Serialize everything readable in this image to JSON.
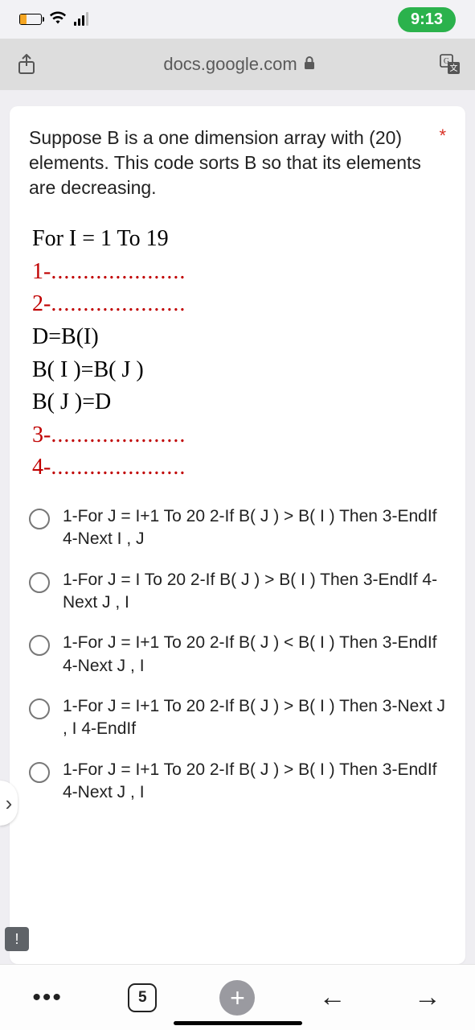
{
  "status": {
    "time": "9:13"
  },
  "browser": {
    "url": "docs.google.com"
  },
  "question": {
    "text": "Suppose B is a one dimension array with (20) elements. This code sorts B so that its elements are decreasing.",
    "required_marker": "*"
  },
  "code": {
    "line1": "For I = 1 To 19",
    "blank1_label": "1-",
    "blank2_label": "2-",
    "line_d": "D=B(I)",
    "line_bi": "B( I )=B( J )",
    "line_bj": "B( J )=D",
    "blank3_label": "3-",
    "blank4_label": "4-",
    "dots": "....................."
  },
  "options": [
    "1-For J = I+1 To 20 2-If B( J ) > B( I ) Then 3-EndIf 4-Next I , J",
    "1-For J = I To 20 2-If B( J ) > B( I ) Then 3-EndIf 4-Next J , I",
    "1-For J = I+1 To 20 2-If B( J ) < B( I ) Then 3-EndIf 4-Next J , I",
    "1-For J = I+1 To 20 2-If B( J ) > B( I ) Then 3-Next J , I 4-EndIf",
    "1-For J = I+1 To 20 2-If B( J ) > B( I ) Then 3-EndIf 4-Next J , I"
  ],
  "nav": {
    "tab_count": "5",
    "plus": "+",
    "back": "←",
    "forward": "→",
    "menu_dots": "•••"
  },
  "edge_peek": "›",
  "alert": "!"
}
